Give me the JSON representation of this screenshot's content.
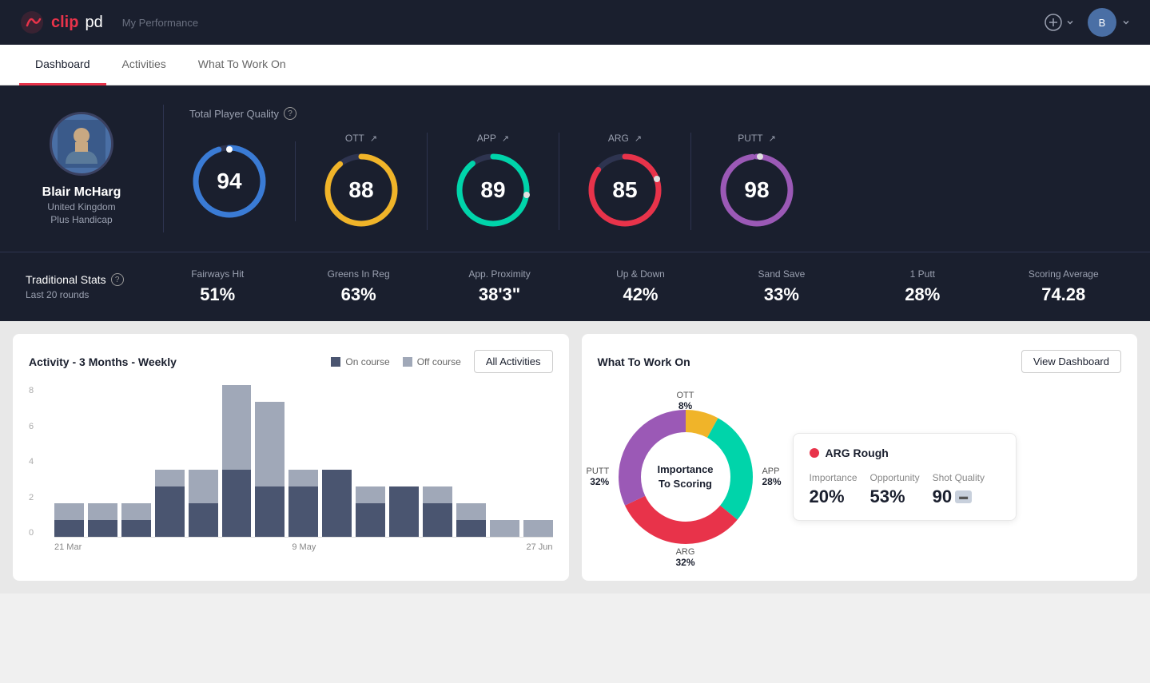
{
  "header": {
    "logo": "clippd",
    "logo_clip": "clip",
    "logo_d": "pd",
    "title": "My Performance",
    "add_icon": "⊕",
    "user_initial": "B"
  },
  "nav": {
    "tabs": [
      {
        "label": "Dashboard",
        "active": true
      },
      {
        "label": "Activities",
        "active": false
      },
      {
        "label": "What To Work On",
        "active": false
      }
    ]
  },
  "player": {
    "name": "Blair McHarg",
    "country": "United Kingdom",
    "handicap": "Plus Handicap"
  },
  "quality": {
    "label": "Total Player Quality",
    "main_score": "94",
    "metrics": [
      {
        "label": "OTT",
        "score": "88",
        "color": "#f0b429",
        "track": "#2e3450"
      },
      {
        "label": "APP",
        "score": "89",
        "color": "#00d4aa",
        "track": "#2e3450"
      },
      {
        "label": "ARG",
        "score": "85",
        "color": "#e8334a",
        "track": "#2e3450"
      },
      {
        "label": "PUTT",
        "score": "98",
        "color": "#9b59b6",
        "track": "#2e3450"
      }
    ]
  },
  "trad_stats": {
    "label": "Traditional Stats",
    "sub_label": "Last 20 rounds",
    "stats": [
      {
        "name": "Fairways Hit",
        "value": "51%"
      },
      {
        "name": "Greens In Reg",
        "value": "63%"
      },
      {
        "name": "App. Proximity",
        "value": "38'3\""
      },
      {
        "name": "Up & Down",
        "value": "42%"
      },
      {
        "name": "Sand Save",
        "value": "33%"
      },
      {
        "name": "1 Putt",
        "value": "28%"
      },
      {
        "name": "Scoring Average",
        "value": "74.28"
      }
    ]
  },
  "activity_chart": {
    "title": "Activity - 3 Months - Weekly",
    "legend": {
      "on_course": "On course",
      "off_course": "Off course"
    },
    "all_activities_btn": "All Activities",
    "y_labels": [
      "8",
      "6",
      "4",
      "2",
      "0"
    ],
    "x_labels": [
      "21 Mar",
      "9 May",
      "27 Jun"
    ],
    "bars": [
      {
        "on": 1,
        "off": 1
      },
      {
        "on": 1,
        "off": 1
      },
      {
        "on": 1,
        "off": 1
      },
      {
        "on": 3,
        "off": 1
      },
      {
        "on": 2,
        "off": 2
      },
      {
        "on": 4,
        "off": 5
      },
      {
        "on": 3,
        "off": 5
      },
      {
        "on": 3,
        "off": 1
      },
      {
        "on": 4,
        "off": 0
      },
      {
        "on": 2,
        "off": 1
      },
      {
        "on": 3,
        "off": 0
      },
      {
        "on": 2,
        "off": 1
      },
      {
        "on": 1,
        "off": 1
      },
      {
        "on": 0,
        "off": 1
      },
      {
        "on": 0,
        "off": 1
      }
    ]
  },
  "what_to_work_on": {
    "title": "What To Work On",
    "view_dashboard_btn": "View Dashboard",
    "donut_center": "Importance\nTo Scoring",
    "segments": [
      {
        "label": "OTT",
        "value": "8%",
        "color": "#f0b429"
      },
      {
        "label": "APP",
        "value": "28%",
        "color": "#00d4aa"
      },
      {
        "label": "ARG",
        "value": "32%",
        "color": "#e8334a"
      },
      {
        "label": "PUTT",
        "value": "32%",
        "color": "#9b59b6"
      }
    ],
    "info_card": {
      "category": "ARG Rough",
      "dot_color": "#e8334a",
      "metrics": [
        {
          "label": "Importance",
          "value": "20%"
        },
        {
          "label": "Opportunity",
          "value": "53%"
        },
        {
          "label": "Shot Quality",
          "value": "90"
        }
      ]
    }
  }
}
